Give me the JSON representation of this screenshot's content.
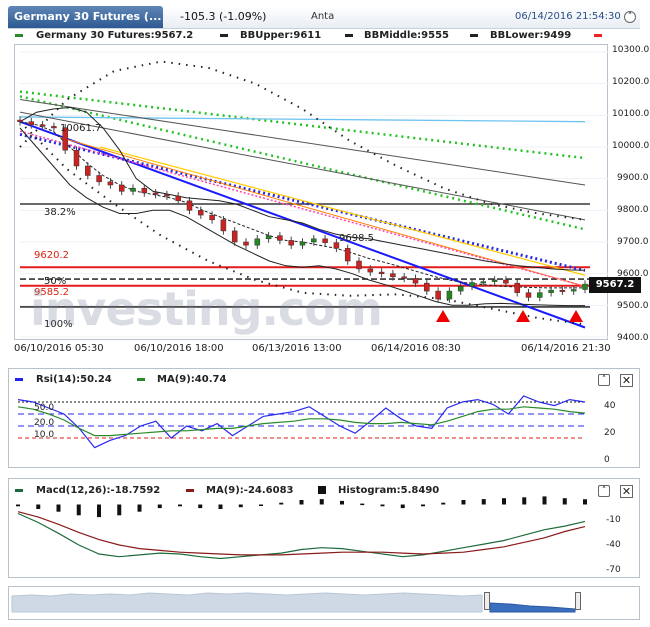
{
  "header": {
    "title": "Germany 30 Futures (...",
    "change": "-105.3 (-1.09%)",
    "exchange": "Anta",
    "datetime": "06/14/2016 21:54:30"
  },
  "legend": {
    "main": "Germany 30 Futures:9567.2",
    "bb_upper": "BBUpper:9611",
    "bb_middle": "BBMiddle:9555",
    "bb_lower": "BBLower:9499"
  },
  "annotations": {
    "fib_382": "38.2%",
    "fib_50": "50%",
    "fib_618": "9585.2",
    "fib_100": "100%",
    "level_9620": "9620.2",
    "peak_label": "10061.7",
    "mid_label": "9698.5",
    "price_tag": "9567.2",
    "watermark": "investing.com"
  },
  "colors": {
    "candle_up": "#1f8a1f",
    "candle_down": "#cc2222",
    "bb": "#222222",
    "trend_blue": "#1a1aff",
    "resistance": "#e21b1b",
    "green_dots": "#22c222",
    "header_tab": "#3a6aa5"
  },
  "chart_data": [
    {
      "type": "candlestick",
      "title": "Germany 30 Futures",
      "x_tick_labels": [
        "06/10/2016 05:30",
        "06/10/2016 18:00",
        "06/13/2016 13:00",
        "06/14/2016 08:30",
        "06/14/2016 21:30"
      ],
      "y_tick_labels": [
        "10300.0",
        "10200.0",
        "10100.0",
        "10000.0",
        "9900.0",
        "9800.0",
        "9700.0",
        "9600.0",
        "9500.0",
        "9400.0"
      ],
      "ylim": [
        9400,
        10300
      ],
      "series": [
        {
          "name": "Germany 30 Futures",
          "values": [
            10080,
            10070,
            10065,
            10061,
            9990,
            9940,
            9910,
            9890,
            9880,
            9860,
            9870,
            9855,
            9850,
            9845,
            9830,
            9800,
            9785,
            9770,
            9735,
            9700,
            9690,
            9710,
            9720,
            9705,
            9690,
            9700,
            9710,
            9698,
            9680,
            9640,
            9615,
            9605,
            9600,
            9590,
            9585,
            9570,
            9545,
            9520,
            9545,
            9560,
            9572,
            9575,
            9580,
            9570,
            9540,
            9525,
            9540,
            9548,
            9545,
            9550,
            9567
          ]
        },
        {
          "name": "BBUpper",
          "values": [
            10080,
            10110,
            10120,
            10125,
            10110,
            10060,
            9990,
            9900,
            9860,
            9850,
            9840,
            9835,
            9830,
            9820,
            9800,
            9780,
            9770,
            9760,
            9740,
            9725,
            9715,
            9710,
            9700,
            9690,
            9680,
            9670,
            9660,
            9650,
            9640,
            9632,
            9625,
            9620,
            9615,
            9612,
            9611
          ]
        },
        {
          "name": "BBMiddle",
          "values": [
            10080,
            10070,
            10050,
            10000,
            9950,
            9910,
            9880,
            9860,
            9850,
            9840,
            9825,
            9800,
            9780,
            9760,
            9740,
            9720,
            9705,
            9700,
            9690,
            9680,
            9665,
            9648,
            9635,
            9620,
            9605,
            9590,
            9578,
            9570,
            9565,
            9560,
            9558,
            9556,
            9555,
            9555,
            9555
          ]
        },
        {
          "name": "BBLower",
          "values": [
            10060,
            10000,
            9940,
            9880,
            9840,
            9810,
            9790,
            9790,
            9800,
            9800,
            9780,
            9750,
            9720,
            9690,
            9665,
            9640,
            9625,
            9620,
            9625,
            9615,
            9600,
            9580,
            9565,
            9548,
            9530,
            9512,
            9500,
            9500,
            9505,
            9506,
            9504,
            9502,
            9500,
            9499,
            9499
          ]
        }
      ],
      "horizontal_levels": [
        {
          "label": "38.2%",
          "value": 9820
        },
        {
          "label": "9620.2",
          "value": 9620.2
        },
        {
          "label": "50%",
          "value": 9583
        },
        {
          "label": "9585.2",
          "value": 9562
        },
        {
          "label": "100%",
          "value": 9495
        }
      ],
      "current_price": 9567.2
    },
    {
      "type": "line",
      "title": "Rsi(14)",
      "legend": [
        "Rsi(14):50.24",
        "MA(9):40.74"
      ],
      "y_tick_labels": [
        "40",
        "20",
        "0"
      ],
      "left_labels": [
        "50.0",
        "20.0",
        "10.0"
      ],
      "ylim": [
        0,
        60
      ],
      "series": [
        {
          "name": "Rsi(14)",
          "values": [
            52,
            50,
            45,
            40,
            28,
            12,
            18,
            22,
            30,
            34,
            20,
            30,
            26,
            32,
            22,
            30,
            38,
            40,
            42,
            46,
            38,
            30,
            24,
            34,
            45,
            36,
            30,
            28,
            45,
            50,
            52,
            48,
            40,
            55,
            50,
            47,
            52,
            50
          ]
        },
        {
          "name": "MA(9)",
          "values": [
            46,
            44,
            40,
            35,
            28,
            22,
            22,
            23,
            24,
            25,
            26,
            26,
            27,
            28,
            28,
            30,
            32,
            33,
            34,
            36,
            36,
            35,
            33,
            32,
            32,
            33,
            32,
            31,
            34,
            38,
            42,
            44,
            44,
            46,
            45,
            44,
            42,
            40.74
          ]
        }
      ]
    },
    {
      "type": "bar",
      "title": "Macd(12,26)",
      "legend": [
        "Macd(12,26):-18.7592",
        "MA(9):-24.6083",
        "Histogram:5.8490"
      ],
      "y_tick_labels": [
        "-10",
        "-40",
        "-70"
      ],
      "ylim": [
        -75,
        5
      ],
      "series": [
        {
          "name": "Macd(12,26)",
          "values": [
            -10,
            -20,
            -32,
            -45,
            -55,
            -58,
            -56,
            -54,
            -55,
            -58,
            -60,
            -58,
            -56,
            -54,
            -50,
            -48,
            -49,
            -52,
            -55,
            -58,
            -56,
            -52,
            -48,
            -44,
            -40,
            -34,
            -28,
            -24,
            -18.76
          ]
        },
        {
          "name": "MA(9)",
          "values": [
            -8,
            -14,
            -22,
            -31,
            -39,
            -45,
            -49,
            -51,
            -53,
            -54,
            -55,
            -56,
            -56,
            -56,
            -55,
            -54,
            -53,
            -53,
            -53,
            -54,
            -55,
            -54,
            -53,
            -50,
            -47,
            -42,
            -37,
            -30,
            -24.61
          ]
        },
        {
          "name": "Histogram",
          "values": [
            -2,
            -5,
            -8,
            -12,
            -14,
            -12,
            -8,
            -4,
            -2,
            -4,
            -5,
            -3,
            -1,
            2,
            5,
            6,
            4,
            1,
            -2,
            -4,
            -2,
            2,
            5,
            6,
            7,
            8,
            9,
            7,
            5.85
          ]
        }
      ]
    }
  ]
}
